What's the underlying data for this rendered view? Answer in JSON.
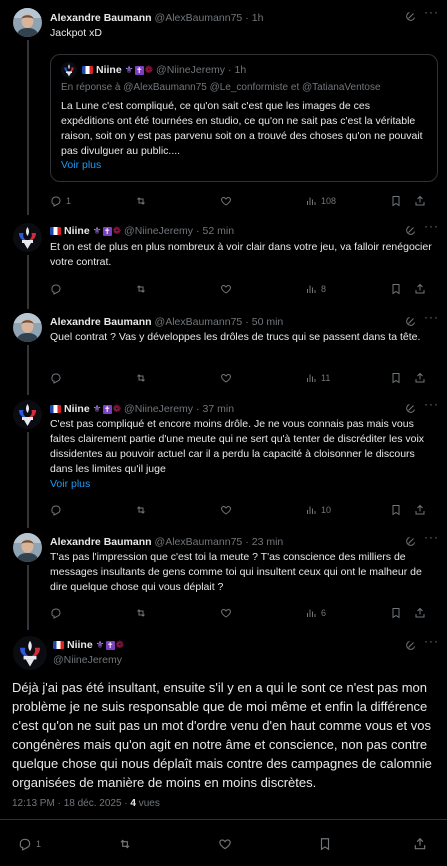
{
  "tweets": [
    {
      "name": "Alexandre Baumann",
      "handle": "@AlexBaumann75",
      "time": "1h",
      "text": "Jackpot xD",
      "replies": "1",
      "views": "108"
    },
    {
      "name": "Niine",
      "handle": "@NiineJeremy",
      "time": "52 min",
      "text": "Et on est de plus en plus nombreux à voir clair dans votre jeu, va falloir renégocier votre contrat.",
      "views": "8"
    },
    {
      "name": "Alexandre Baumann",
      "handle": "@AlexBaumann75",
      "time": "50 min",
      "text": "Quel contrat ? Vas y développes les drôles de trucs qui se passent dans ta tête.",
      "views": "11"
    },
    {
      "name": "Niine",
      "handle": "@NiineJeremy",
      "time": "37 min",
      "text": "C'est pas compliqué et encore moins drôle. Je ne vous connais pas mais vous faites clairement partie d'une meute qui ne sert qu'à tenter de discréditer les voix dissidentes au pouvoir actuel car il a perdu la capacité à cloisonner le discours dans les limites qu'il juge",
      "show_more": "Voir plus",
      "views": "10"
    },
    {
      "name": "Alexandre Baumann",
      "handle": "@AlexBaumann75",
      "time": "23 min",
      "text": "T'as pas l'impression que c'est toi la meute ? T'as conscience des milliers de messages insultants de gens comme toi qui insultent ceux qui ont le malheur de dire quelque chose qui vous déplait ?",
      "views": "6"
    }
  ],
  "quote": {
    "name": "Niine",
    "handle": "@NiineJeremy",
    "time": "1h",
    "reply_prefix": "En réponse à",
    "reply_to": "@AlexBaumann75 @Le_conformiste  et  @TatianaVentose",
    "text": "La Lune c'est compliqué, ce qu'on sait c'est que les images de ces expéditions ont été tournées en studio, ce qu'on ne sait pas c'est la véritable raison, soit on y est pas parvenu soit on a trouvé des choses qu'on ne pouvait pas divulguer au public....",
    "show_more": "Voir plus"
  },
  "main": {
    "name": "Niine",
    "handle": "@NiineJeremy",
    "text": "Déjà j'ai pas été insultant, ensuite s'il y en a qui le sont ce n'est pas mon problème je ne suis responsable que de moi même et enfin la différence c'est qu'on ne suit pas un mot d'ordre venu d'en haut comme vous et vos congénères mais qu'on agit en notre âme et conscience, non pas contre quelque chose qui nous déplaît mais contre des campagnes de calomnie organisées de manière de moins en moins discrètes.",
    "time": "12:13 PM · 18 déc. 2025 · ",
    "views_count": "4",
    "views_label": " vues",
    "replies": "1"
  },
  "icons": {
    "reply": "reply-icon",
    "retweet": "retweet-icon",
    "like": "heart-icon",
    "views": "views-icon",
    "bookmark": "bookmark-icon",
    "share": "share-icon",
    "grok": "grok-icon",
    "more": "more-icon"
  },
  "colors": {
    "background": "#000000",
    "text": "#e7e9ea",
    "muted": "#71767b",
    "link": "#1d9bf0",
    "border": "#2f3336"
  }
}
